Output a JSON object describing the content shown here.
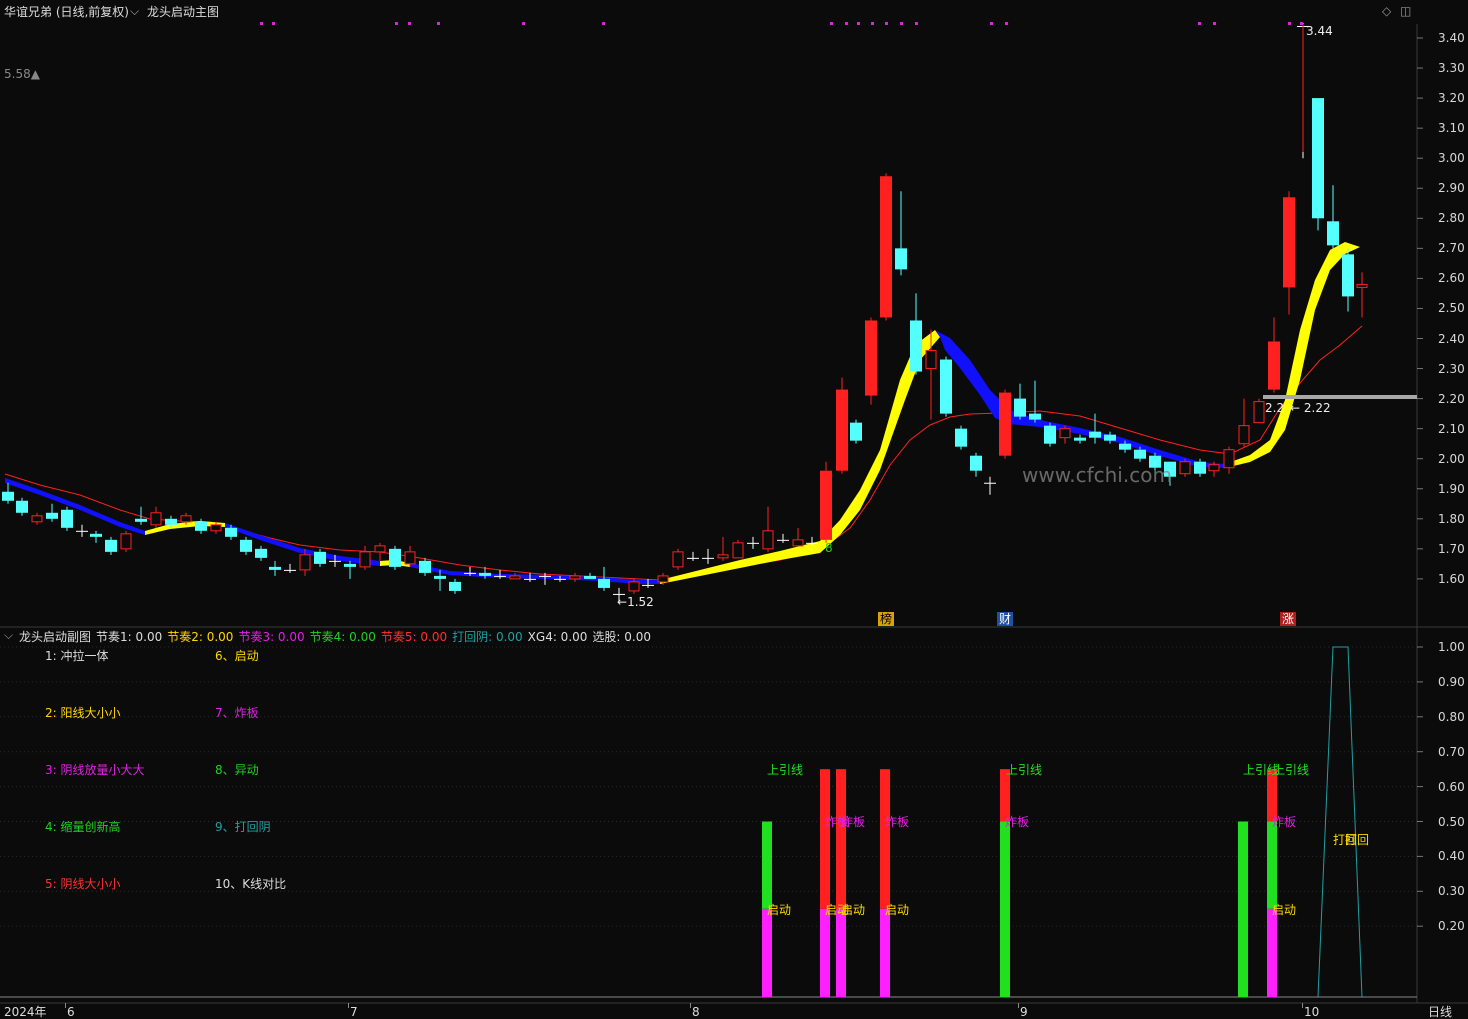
{
  "window": {
    "title": "华谊兄弟 (日线,前复权)",
    "main_indicator": "龙头启动主图"
  },
  "price_axis": [
    "3.40",
    "3.30",
    "3.20",
    "3.10",
    "3.00",
    "2.90",
    "2.80",
    "2.70",
    "2.60",
    "2.50",
    "2.40",
    "2.30",
    "2.20",
    "2.10",
    "2.00",
    "1.90",
    "1.80",
    "1.70",
    "1.60"
  ],
  "left_marker": "5.58▲",
  "annotations": {
    "high": "3.44",
    "low": "1.52",
    "level_left": "2.2",
    "level_right": "2.22",
    "signal_8": "8"
  },
  "badges": {
    "bang": "榜",
    "cai": "财",
    "zhang": "涨"
  },
  "watermark": "www.cfchi.com",
  "sub_chart": {
    "name": "龙头启动副图",
    "params": [
      {
        "label": "节奏1:",
        "value": "0.00",
        "color": "#dddddd"
      },
      {
        "label": "节奏2:",
        "value": "0.00",
        "color": "#ffd700"
      },
      {
        "label": "节奏3:",
        "value": "0.00",
        "color": "#e020e0"
      },
      {
        "label": "节奏4:",
        "value": "0.00",
        "color": "#20d020"
      },
      {
        "label": "节奏5:",
        "value": "0.00",
        "color": "#ff3030"
      },
      {
        "label": "打回阴:",
        "value": "0.00",
        "color": "#20a0a0"
      },
      {
        "label": "XG4:",
        "value": "0.00",
        "color": "#dddddd"
      },
      {
        "label": "选股:",
        "value": "0.00",
        "color": "#dddddd"
      }
    ],
    "axis": [
      "1.00",
      "0.90",
      "0.80",
      "0.70",
      "0.60",
      "0.50",
      "0.40",
      "0.30",
      "0.20"
    ],
    "legend_left": [
      {
        "text": "1:  冲拉一体",
        "color": "#dddddd"
      },
      {
        "text": "2:  阳线大小小",
        "color": "#ffd700"
      },
      {
        "text": "3:  阴线放量小大大",
        "color": "#e020e0"
      },
      {
        "text": "4:  缩量创新高",
        "color": "#20d020"
      },
      {
        "text": "5:  阴线大小小",
        "color": "#ff3030"
      }
    ],
    "legend_right": [
      {
        "text": "6、启动",
        "color": "#ffd700"
      },
      {
        "text": "7、炸板",
        "color": "#e020e0"
      },
      {
        "text": "8、异动",
        "color": "#20d020"
      },
      {
        "text": "9、打回阴",
        "color": "#20a0a0"
      },
      {
        "text": "10、K线对比",
        "color": "#dddddd"
      }
    ],
    "labels": {
      "shangyin": "上引线",
      "zhaban": "炸板",
      "qidong": "启动",
      "dahui": "打回",
      "dahuiyin": "打回"
    }
  },
  "time_axis": [
    "2024年",
    "6",
    "7",
    "8",
    "9",
    "10"
  ],
  "period": "日线",
  "colors": {
    "up": "#ff2020",
    "down": "#54ffff",
    "ribbon_up": "#ffff00",
    "ribbon_down": "#1010ff",
    "ma": "#ff2020"
  }
}
